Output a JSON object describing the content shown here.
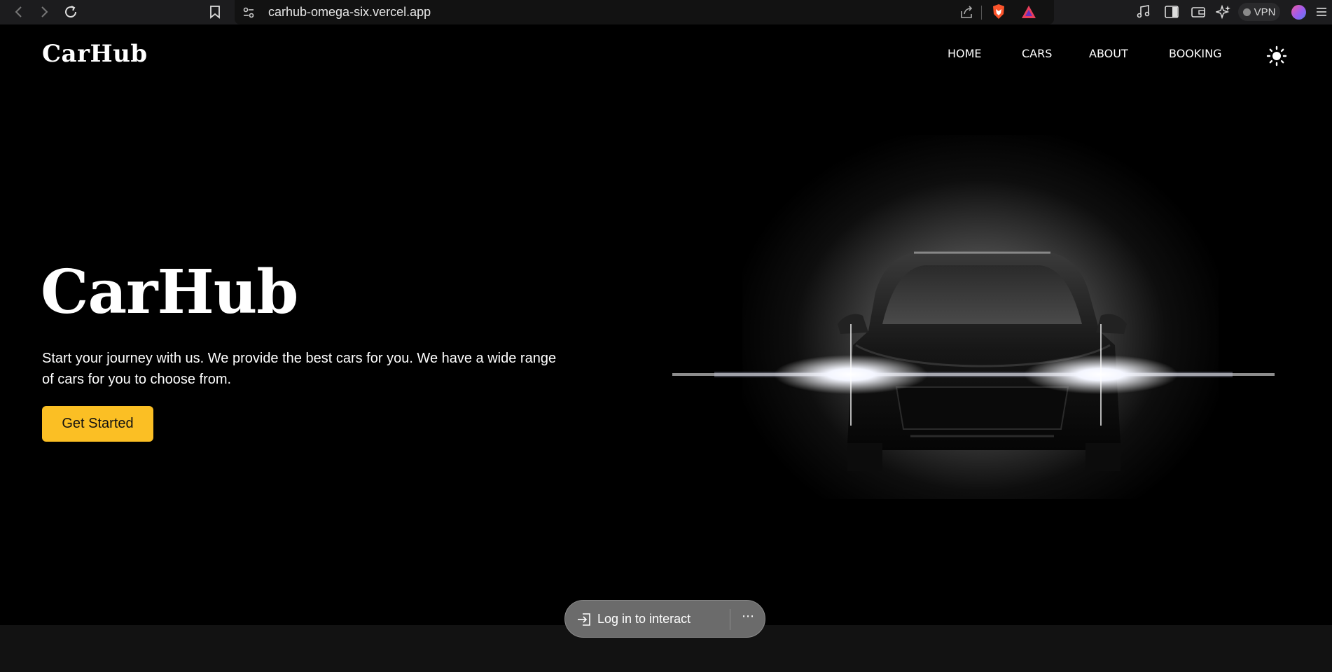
{
  "browser": {
    "url": "carhub-omega-six.vercel.app",
    "vpn_label": "VPN"
  },
  "site": {
    "logo": "CarHub",
    "nav": [
      "HOME",
      "CARS",
      "ABOUT",
      "BOOKING"
    ]
  },
  "hero": {
    "title": "CarHub",
    "description": "Start your journey with us. We provide the best cars for you. We have a wide range of cars for you to choose from.",
    "cta_label": "Get Started"
  },
  "login_pill": {
    "label": "Log in to interact",
    "more": "⋯"
  },
  "colors": {
    "accent": "#fbbf24",
    "background": "#000000",
    "footer": "#121212"
  }
}
